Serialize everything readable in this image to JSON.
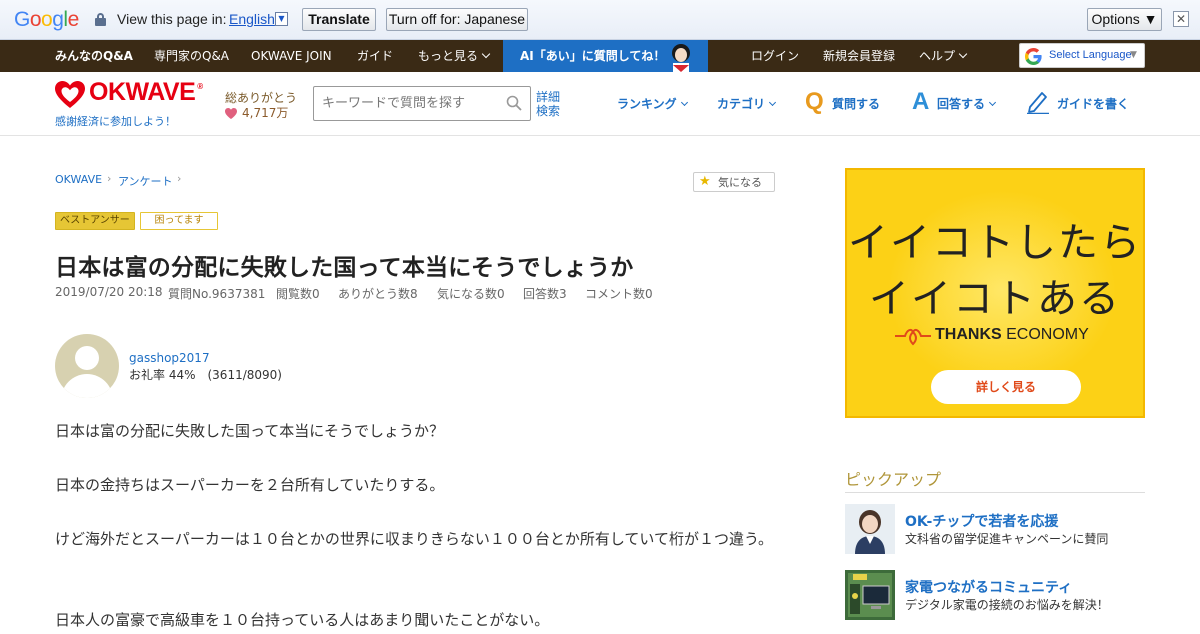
{
  "translate_bar": {
    "logo": "Google",
    "view_text": "View this page in:",
    "language": "English",
    "translate_label": "Translate",
    "turn_off_label": "Turn off for: Japanese",
    "options_label": "Options ▼",
    "close_label": "✕"
  },
  "topnav": {
    "items": [
      "みんなのQ&A",
      "専門家のQ&A",
      "OKWAVE JOIN",
      "ガイド",
      "もっと見る"
    ],
    "ai_banner": "AI「あい」に質問してね！",
    "login": "ログイン",
    "register": "新規会員登録",
    "help": "ヘルプ",
    "select_language": "Select Language",
    "select_arrow": "▼"
  },
  "header": {
    "logo": "OKWAVE",
    "logo_mark": "®",
    "tagline": "感謝経済に参加しよう！",
    "thanks_label": "総ありがとう",
    "thanks_count": "4,717万",
    "search_placeholder": "キーワードで質問を探す",
    "advanced_search": "詳細検索",
    "nav": {
      "ranking": "ランキング",
      "category": "カテゴリ",
      "ask": "質問する",
      "answer": "回答する",
      "write_guide": "ガイドを書く"
    },
    "q_letter": "Q",
    "a_letter": "A"
  },
  "breadcrumb": [
    "OKWAVE",
    "アンケート"
  ],
  "kininaru_label": "気になる",
  "tags": {
    "best_answer": "ベストアンサー",
    "trouble": "困ってます"
  },
  "question": {
    "title": "日本は富の分配に失敗した国って本当にそうでしょうか",
    "meta": {
      "date": "2019/07/20 20:18",
      "number": "質問No.9637381",
      "views": "閲覧数0",
      "thanks": "ありがとう数8",
      "kininaru": "気になる数0",
      "answers": "回答数3",
      "comments": "コメント数0"
    },
    "user": {
      "name": "gasshop2017",
      "rate": "お礼率 44%　(3611/8090)"
    },
    "body": [
      "日本は富の分配に失敗した国って本当にそうでしょうか？",
      "日本の金持ちはスーパーカーを２台所有していたりする。",
      "けど海外だとスーパーカーは１０台とかの世界に収まりきらない１００台とか所有していて桁が１つ違う。",
      "日本人の富豪で高級車を１０台持っている人はあまり聞いたことがない。"
    ]
  },
  "ad": {
    "line1": "イイコトしたら",
    "line2": "イイコトある",
    "brand_bold": "THANKS",
    "brand_rest": " ECONOMY",
    "button": "詳しく見る",
    "colors": {
      "background": "#fcd116",
      "button_text": "#e04a1a"
    }
  },
  "pickup": {
    "title": "ピックアップ",
    "items": [
      {
        "title": "OK-チップで若者を応援",
        "desc": "文科省の留学促進キャンペーンに賛同"
      },
      {
        "title": "家電つながるコミュニティ",
        "desc": "デジタル家電の接続のお悩みを解決！"
      }
    ]
  }
}
